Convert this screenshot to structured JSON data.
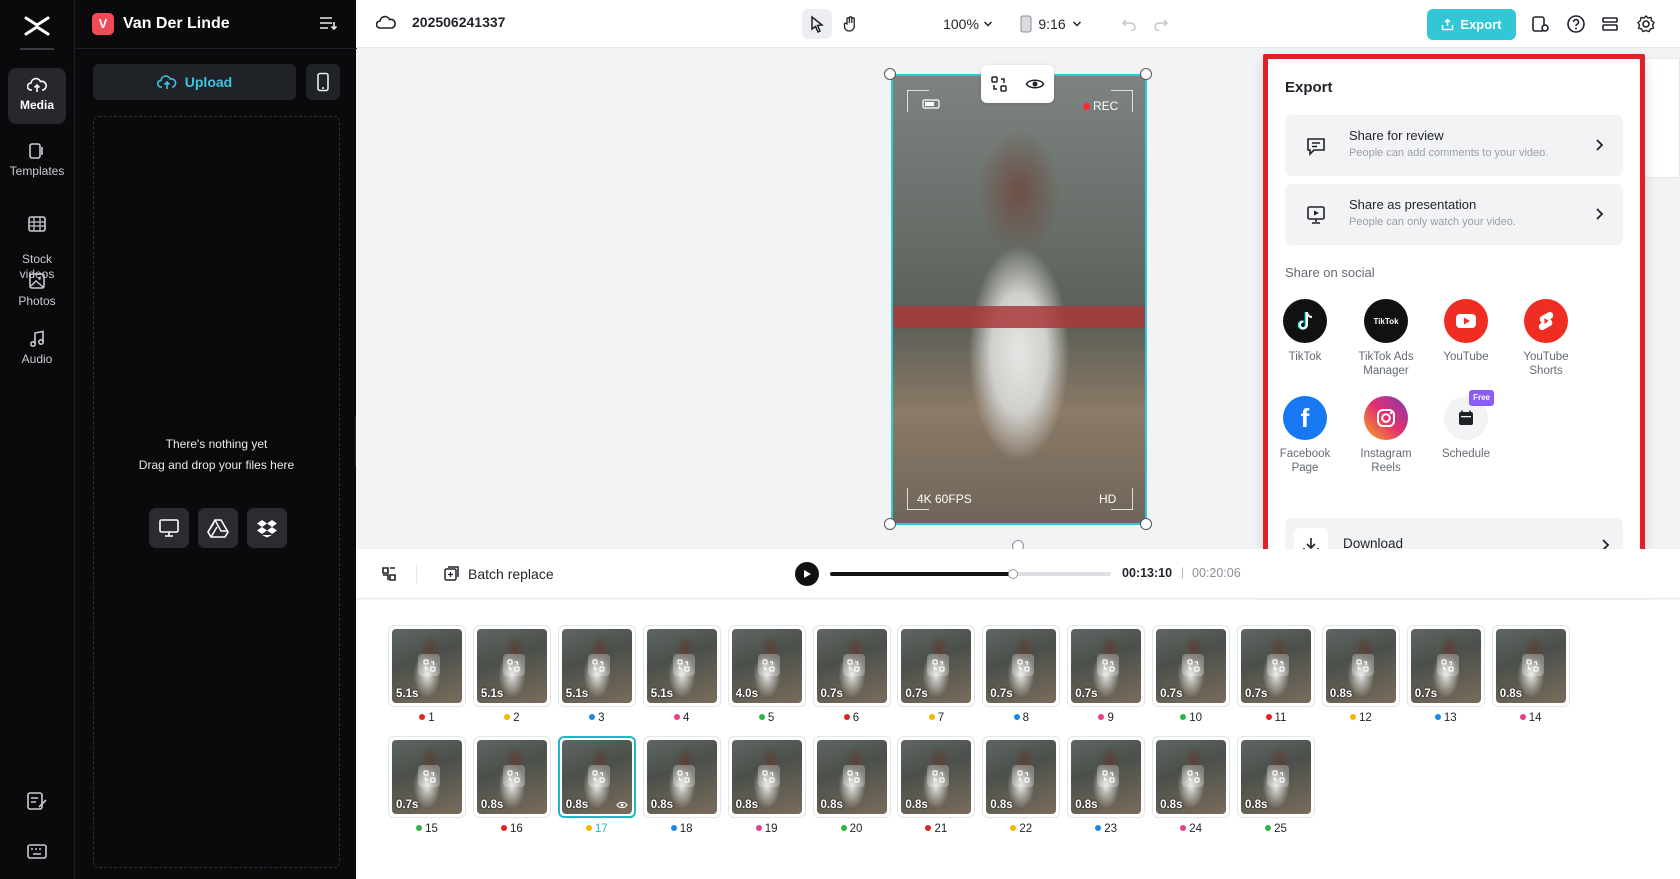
{
  "sidebar": {
    "items": [
      {
        "label": "Media",
        "icon": "cloud-upload-icon"
      },
      {
        "label": "Templates",
        "icon": "templates-icon"
      },
      {
        "label": "Stock\nvideos",
        "icon": "film-icon"
      },
      {
        "label": "Photos",
        "icon": "image-icon"
      },
      {
        "label": "Audio",
        "icon": "music-note-icon"
      }
    ]
  },
  "panel": {
    "workspace": "Van Der Linde",
    "avatar_letter": "V",
    "upload_label": "Upload",
    "empty_line1": "There's nothing yet",
    "empty_line2": "Drag and drop your files here"
  },
  "topbar": {
    "project_name": "202506241337",
    "zoom": "100%",
    "ratio": "9:16",
    "export_label": "Export"
  },
  "video": {
    "rec": "REC",
    "quality_left": "4K 60FPS",
    "quality_right": "HD"
  },
  "export_panel": {
    "title": "Export",
    "share_review_title": "Share for review",
    "share_review_sub": "People can add comments to your video.",
    "share_presentation_title": "Share as presentation",
    "share_presentation_sub": "People can only watch your video.",
    "social_label": "Share on social",
    "socials": [
      "TikTok",
      "TikTok Ads Manager",
      "YouTube",
      "YouTube Shorts",
      "Facebook Page",
      "Instagram Reels",
      "Schedule"
    ],
    "free_badge": "Free",
    "download_label": "Download"
  },
  "timeline": {
    "batch_replace": "Batch replace",
    "current_time": "00:13:10",
    "separator": "|",
    "total_time": "00:20:06",
    "progress": 0.65
  },
  "clips": [
    {
      "n": "1",
      "dur": "5.1s",
      "color": "#e02424"
    },
    {
      "n": "2",
      "dur": "5.1s",
      "color": "#f5b800"
    },
    {
      "n": "3",
      "dur": "5.1s",
      "color": "#1e88e5"
    },
    {
      "n": "4",
      "dur": "5.1s",
      "color": "#e83e8c"
    },
    {
      "n": "5",
      "dur": "4.0s",
      "color": "#2fb344"
    },
    {
      "n": "6",
      "dur": "0.7s",
      "color": "#e02424"
    },
    {
      "n": "7",
      "dur": "0.7s",
      "color": "#f5b800"
    },
    {
      "n": "8",
      "dur": "0.7s",
      "color": "#1e88e5"
    },
    {
      "n": "9",
      "dur": "0.7s",
      "color": "#e83e8c"
    },
    {
      "n": "10",
      "dur": "0.7s",
      "color": "#2fb344"
    },
    {
      "n": "11",
      "dur": "0.7s",
      "color": "#e02424"
    },
    {
      "n": "12",
      "dur": "0.8s",
      "color": "#f5b800"
    },
    {
      "n": "13",
      "dur": "0.7s",
      "color": "#1e88e5"
    },
    {
      "n": "14",
      "dur": "0.8s",
      "color": "#e83e8c"
    },
    {
      "n": "15",
      "dur": "0.7s",
      "color": "#2fb344"
    },
    {
      "n": "16",
      "dur": "0.8s",
      "color": "#e02424"
    },
    {
      "n": "17",
      "dur": "0.8s",
      "color": "#f5b800",
      "selected": true
    },
    {
      "n": "18",
      "dur": "0.8s",
      "color": "#1e88e5"
    },
    {
      "n": "19",
      "dur": "0.8s",
      "color": "#e83e8c"
    },
    {
      "n": "20",
      "dur": "0.8s",
      "color": "#2fb344"
    },
    {
      "n": "21",
      "dur": "0.8s",
      "color": "#e02424"
    },
    {
      "n": "22",
      "dur": "0.8s",
      "color": "#f5b800"
    },
    {
      "n": "23",
      "dur": "0.8s",
      "color": "#1e88e5"
    },
    {
      "n": "24",
      "dur": "0.8s",
      "color": "#e83e8c"
    },
    {
      "n": "25",
      "dur": "0.8s",
      "color": "#2fb344"
    }
  ]
}
